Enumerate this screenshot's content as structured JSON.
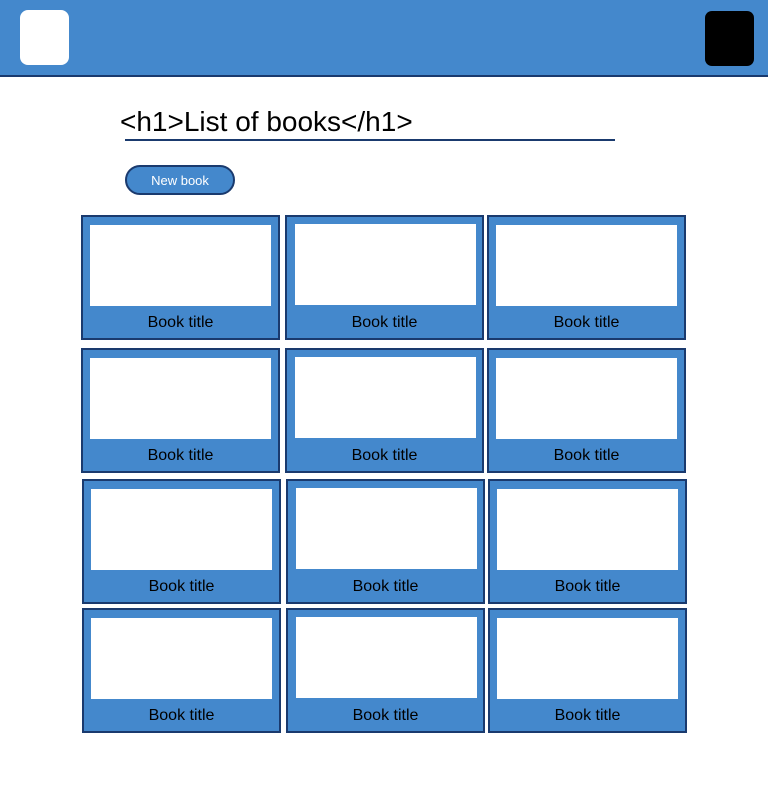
{
  "header": {
    "logo_icon": "logo-icon",
    "user_icon": "user-avatar-icon",
    "background_color": "#4488cc"
  },
  "main": {
    "heading": "<h1>List of books</h1>",
    "new_book_label": "New book"
  },
  "books": [
    {
      "title": "Book title"
    },
    {
      "title": "Book title"
    },
    {
      "title": "Book title"
    },
    {
      "title": "Book title"
    },
    {
      "title": "Book title"
    },
    {
      "title": "Book title"
    },
    {
      "title": "Book title"
    },
    {
      "title": "Book title"
    },
    {
      "title": "Book title"
    },
    {
      "title": "Book title"
    },
    {
      "title": "Book title"
    },
    {
      "title": "Book title"
    }
  ]
}
